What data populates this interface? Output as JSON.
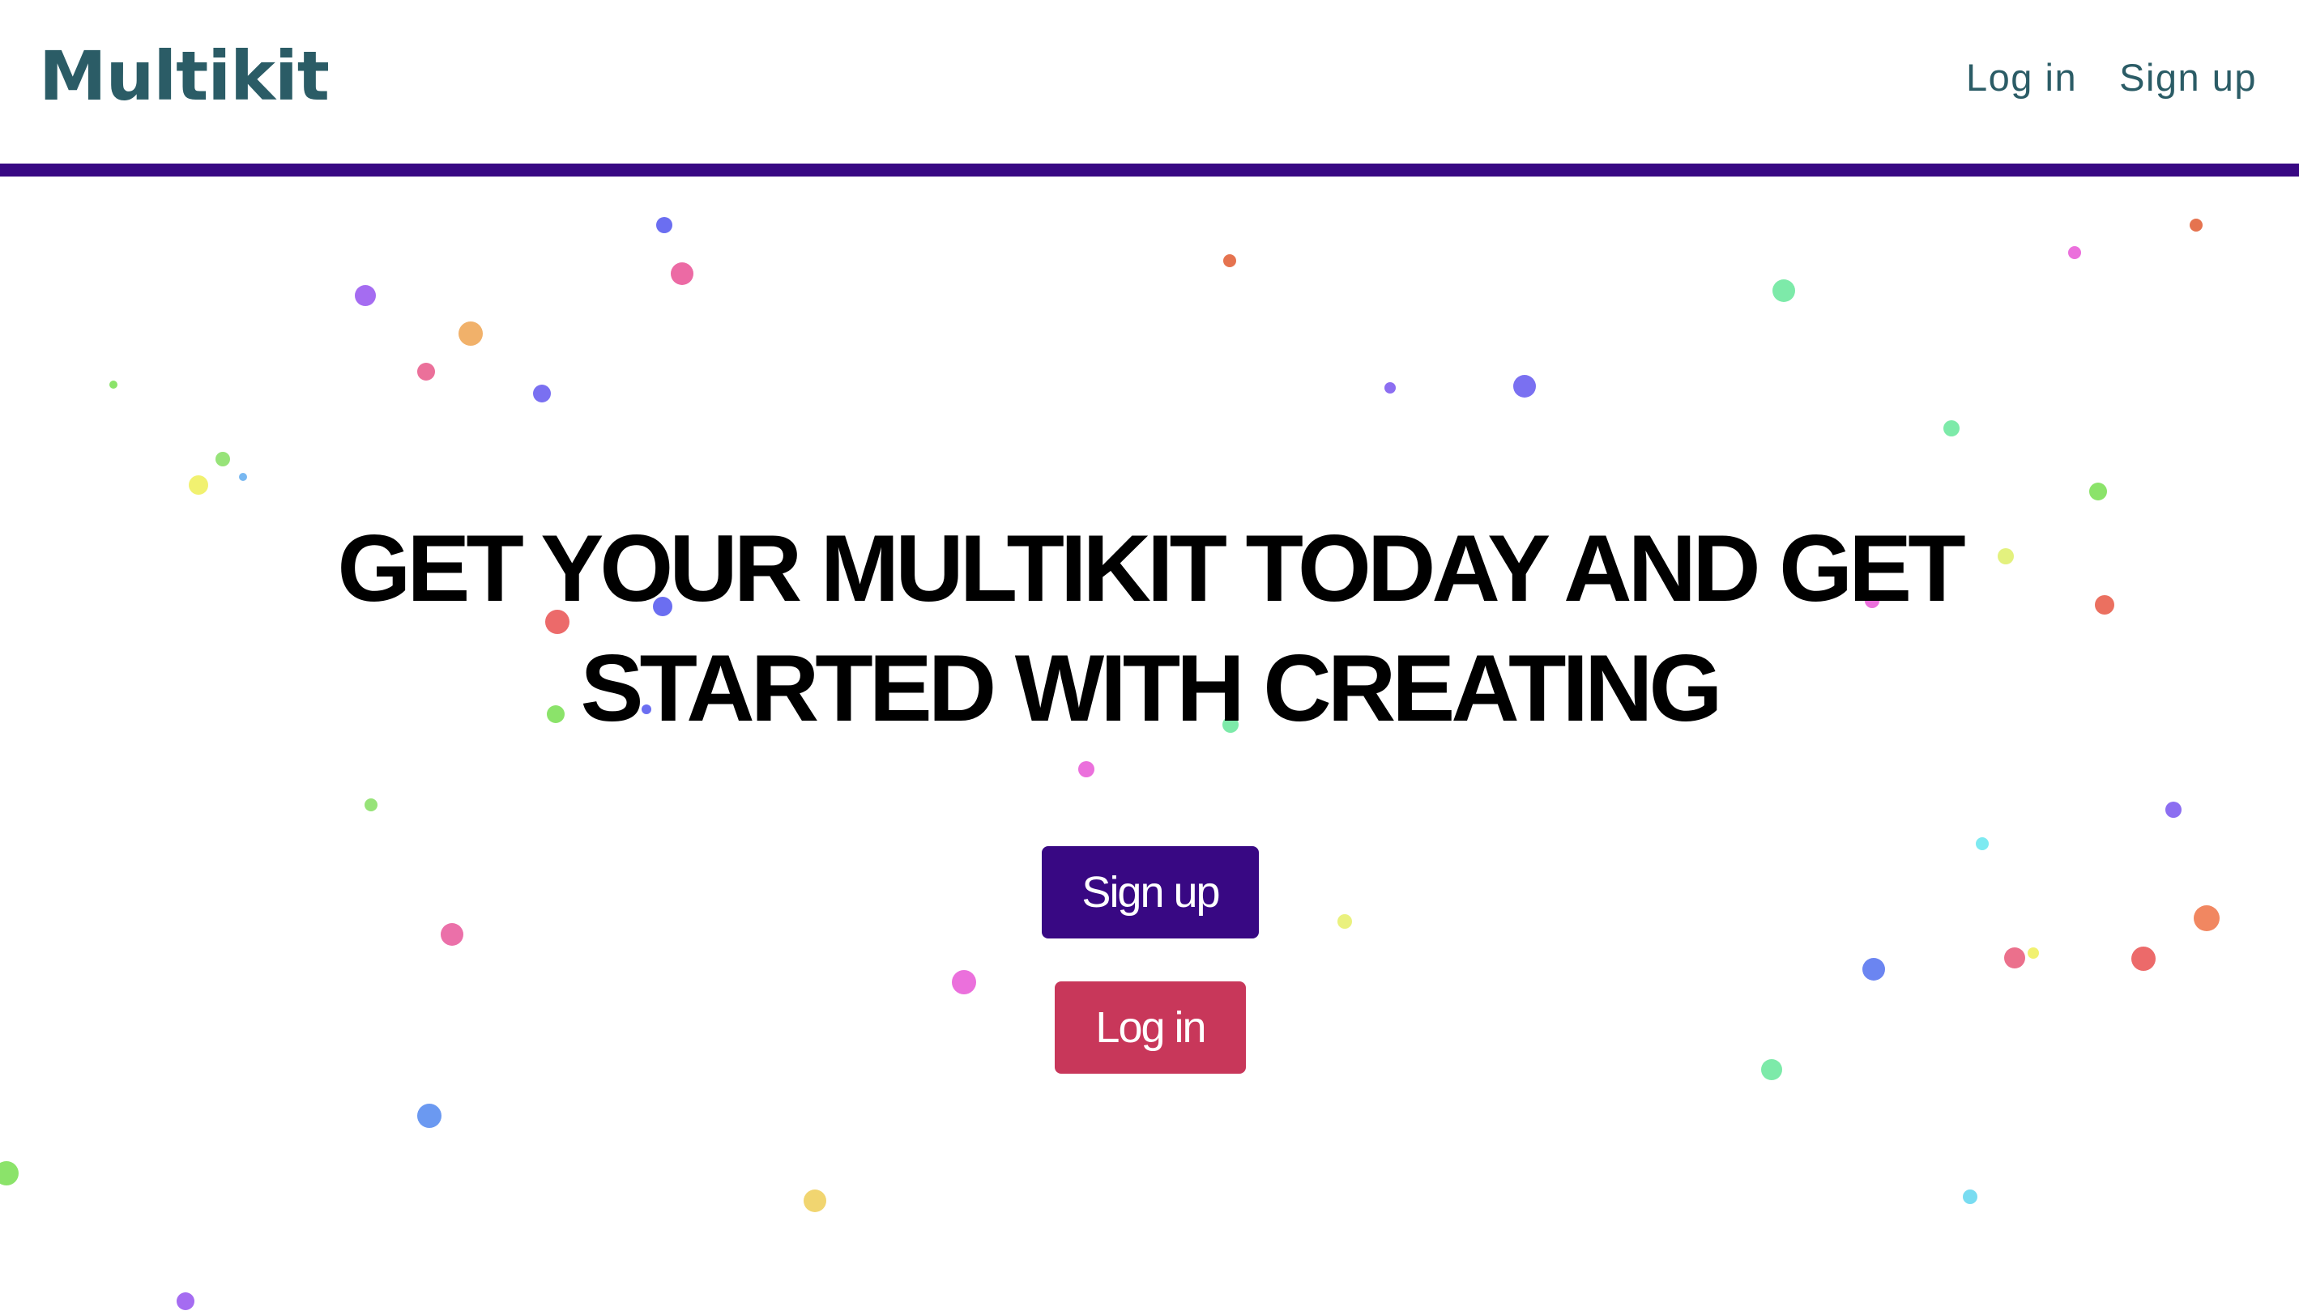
{
  "header": {
    "logo": "Multikit",
    "nav": {
      "login_label": "Log in",
      "signup_label": "Sign up"
    }
  },
  "hero": {
    "headline": "GET YOUR MULTIKIT TODAY AND GET STARTED WITH CREATING",
    "signup_button": "Sign up",
    "login_button": "Log in"
  },
  "colors": {
    "brand_text": "#2b5c66",
    "accent_bar": "#380883",
    "signup_button_bg": "#380883",
    "login_button_bg": "#c8375a"
  }
}
